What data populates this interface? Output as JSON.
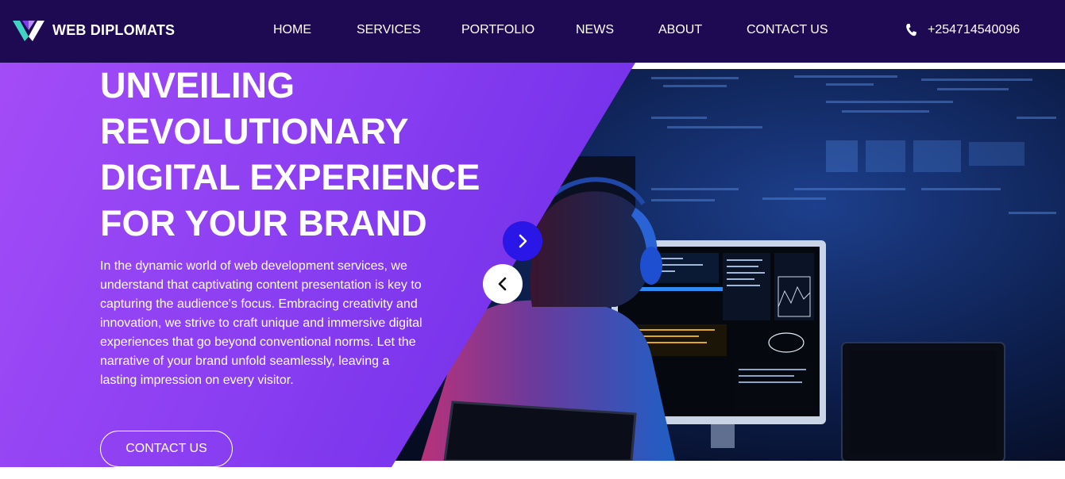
{
  "brand": {
    "name": "WEB DIPLOMATS",
    "logo_icon": "v-logo-icon"
  },
  "nav": {
    "items": [
      {
        "label": "HOME"
      },
      {
        "label": "SERVICES"
      },
      {
        "label": "PORTFOLIO"
      },
      {
        "label": "NEWS"
      },
      {
        "label": "ABOUT"
      },
      {
        "label": "CONTACT US"
      }
    ],
    "phone": "+254714540096",
    "phone_icon": "phone-icon"
  },
  "hero": {
    "headline_lines": [
      "UNVEILING",
      "REVOLUTIONARY",
      "DIGITAL EXPERIENCE",
      "FOR YOUR BRAND"
    ],
    "description": "In the dynamic world of web development services, we understand that captivating content presentation is key to capturing the audience's focus. Embracing creativity and innovation, we strive to craft unique and immersive digital experiences that go beyond conventional norms. Let the narrative of your brand unfold seamlessly, leaving a lasting impression on every visitor.",
    "cta_label": "CONTACT US",
    "next_icon": "chevron-right-icon",
    "prev_icon": "chevron-left-icon"
  },
  "colors": {
    "navbar": "#1e0a52",
    "gradient_start": "#a34cf7",
    "gradient_end": "#6a2be6",
    "next_button": "#2a16e6",
    "prev_button": "#ffffff"
  }
}
